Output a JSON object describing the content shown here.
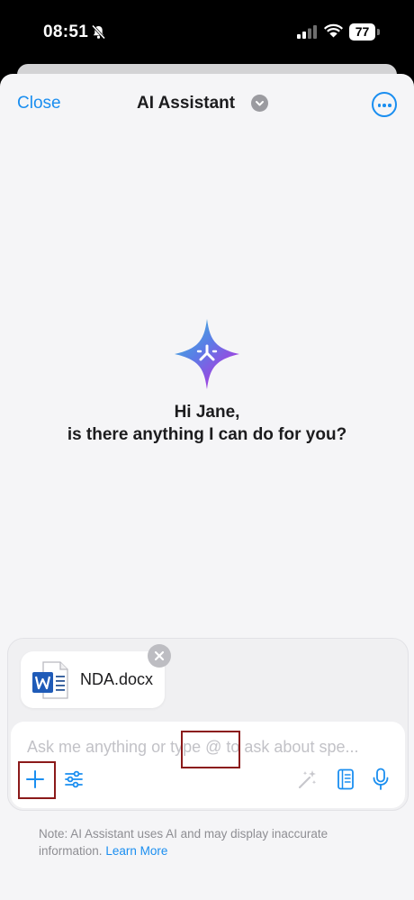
{
  "status_bar": {
    "time": "08:51",
    "battery": "77"
  },
  "nav": {
    "close_label": "Close",
    "title": "AI Assistant"
  },
  "greeting": {
    "line1": "Hi Jane,",
    "line2": "is there anything I can do for you?"
  },
  "attachment": {
    "file_name": "NDA.docx",
    "file_type_icon": "word-doc-icon"
  },
  "input": {
    "placeholder": "Ask me anything or type @ to ask about spe..."
  },
  "toolbar": {
    "icons": [
      "plus-icon",
      "sliders-icon",
      "magic-wand-icon",
      "notebook-icon",
      "microphone-icon"
    ]
  },
  "footer": {
    "note": "Note: AI Assistant uses AI and may display inaccurate information.",
    "learn_more": "Learn More"
  },
  "colors": {
    "accent": "#1a8ef0",
    "highlight_box": "#8b1a1a",
    "sheet_bg": "#f5f5f7"
  }
}
